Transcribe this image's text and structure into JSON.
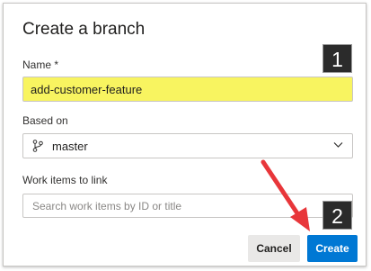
{
  "dialog": {
    "title": "Create a branch",
    "name_label": "Name *",
    "name_value": "add-customer-feature",
    "based_on_label": "Based on",
    "based_on_value": "master",
    "work_items_label": "Work items to link",
    "work_items_placeholder": "Search work items by ID or title",
    "cancel_label": "Cancel",
    "create_label": "Create"
  },
  "annotations": {
    "badge_1": "1",
    "badge_2": "2",
    "arrow_color": "#e8363a"
  },
  "colors": {
    "highlight": "#f8f460",
    "primary": "#0078d4"
  }
}
